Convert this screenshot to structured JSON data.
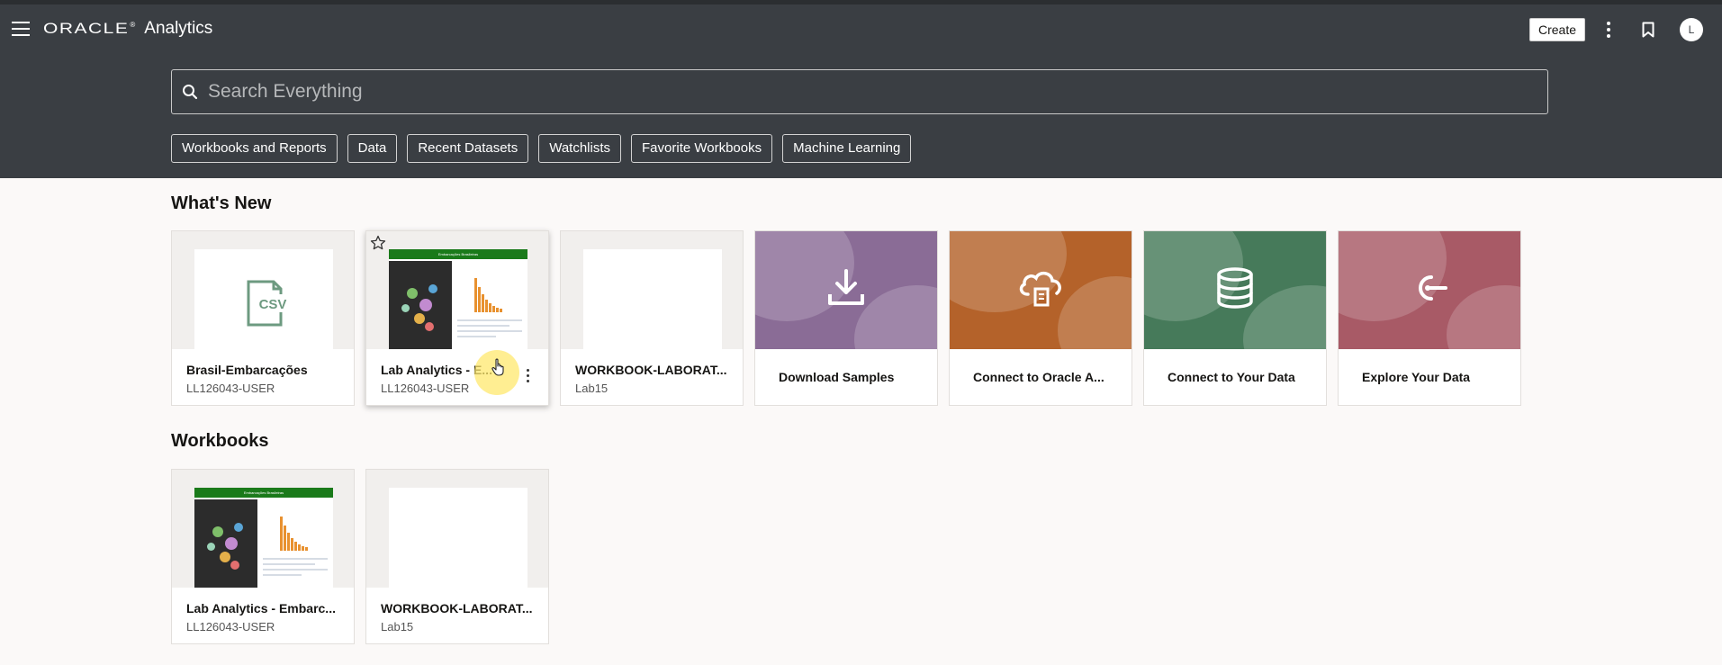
{
  "header": {
    "brand_oracle": "ORACLE",
    "brand_reg": "®",
    "brand_app": "Analytics",
    "create_label": "Create",
    "avatar_initial": "L"
  },
  "search": {
    "placeholder": "Search Everything"
  },
  "chips": [
    "Workbooks and Reports",
    "Data",
    "Recent Datasets",
    "Watchlists",
    "Favorite Workbooks",
    "Machine Learning"
  ],
  "whats_new": {
    "title": "What's New",
    "items": [
      {
        "title": "Brasil-Embarcações",
        "subtitle": "LL126043-USER",
        "thumb_text": "CSV"
      },
      {
        "title": "Lab Analytics - E...",
        "subtitle": "LL126043-USER",
        "thumb_header": "Embarcações Brasileiras"
      },
      {
        "title": "WORKBOOK-LABORAT...",
        "subtitle": "Lab15"
      }
    ],
    "tiles": [
      {
        "label": "Download Samples",
        "color": "#8a6c96",
        "icon": "download-icon"
      },
      {
        "label": "Connect to Oracle A...",
        "color": "#b4622a",
        "icon": "cloud-icon"
      },
      {
        "label": "Connect to Your Data",
        "color": "#467a5a",
        "icon": "database-icon"
      },
      {
        "label": "Explore Your Data",
        "color": "#a85a66",
        "icon": "explore-icon"
      }
    ]
  },
  "workbooks": {
    "title": "Workbooks",
    "items": [
      {
        "title": "Lab Analytics - Embarc...",
        "subtitle": "LL126043-USER",
        "thumb_header": "Embarcações Brasileiras"
      },
      {
        "title": "WORKBOOK-LABORAT...",
        "subtitle": "Lab15"
      }
    ]
  }
}
